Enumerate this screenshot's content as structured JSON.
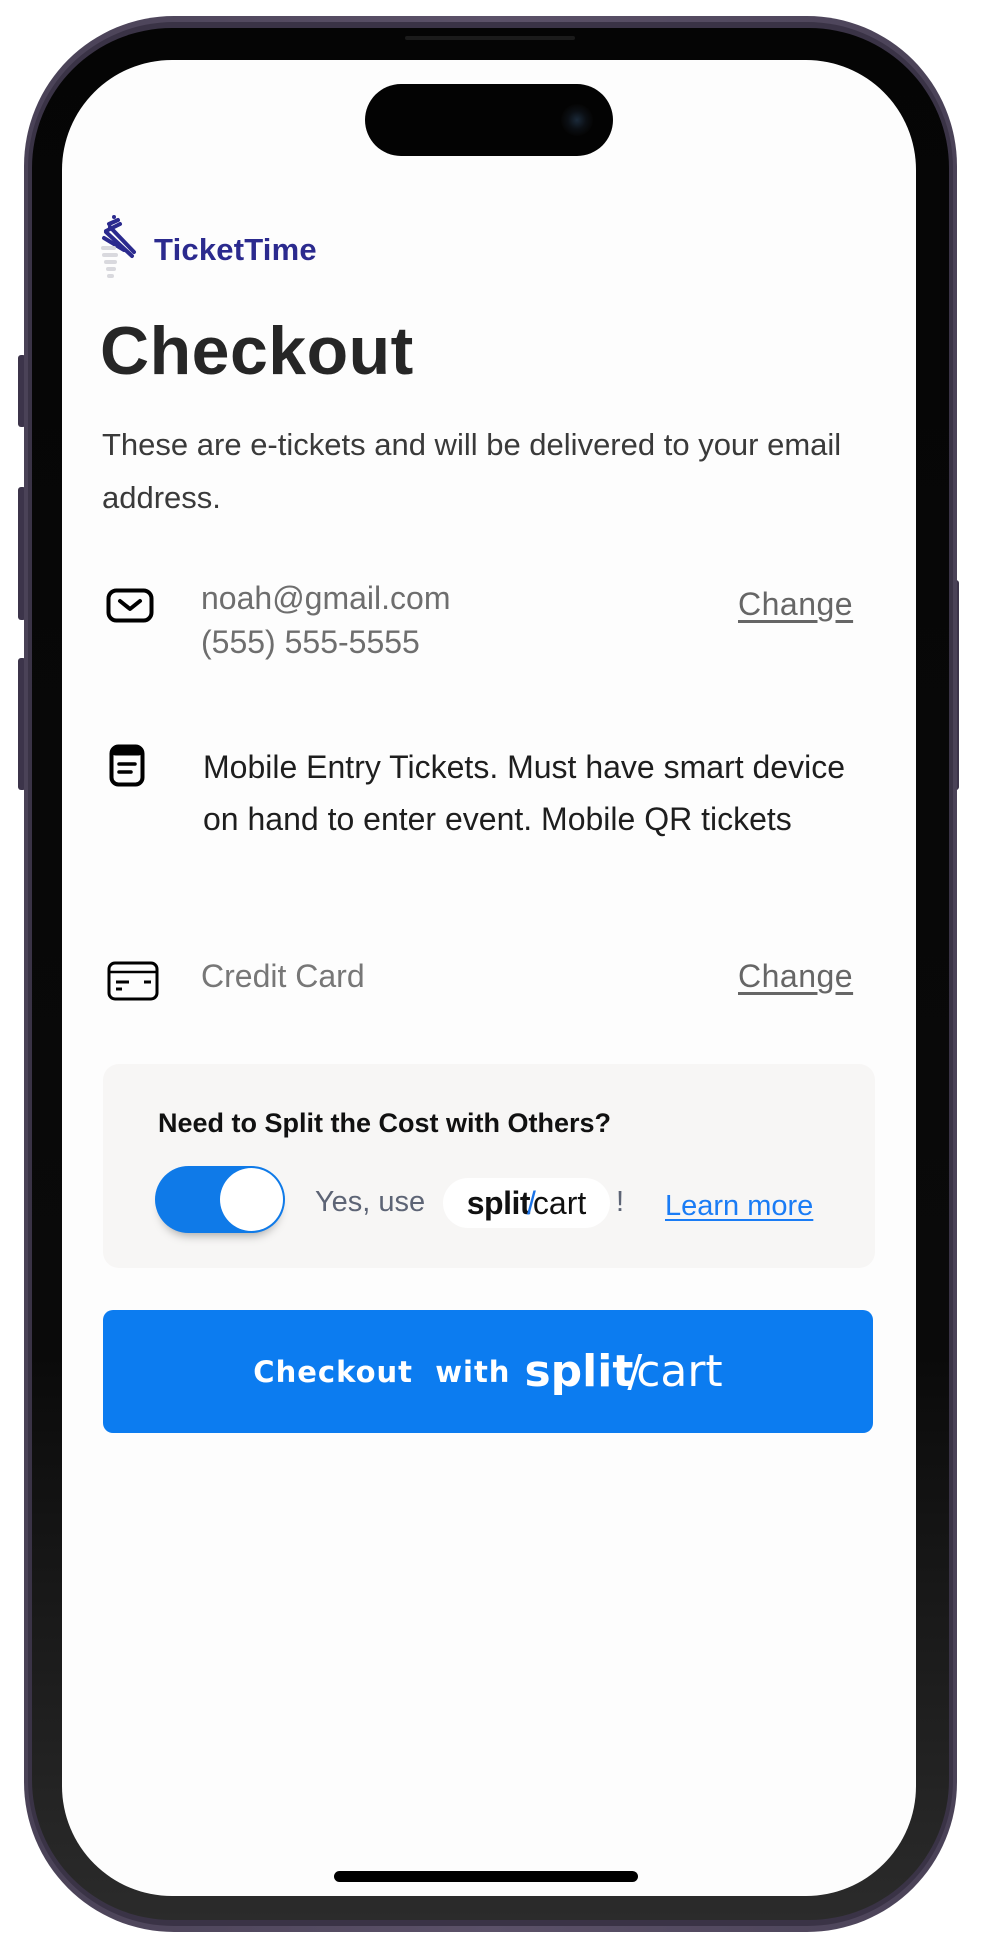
{
  "brand": {
    "name": "TicketTime",
    "color": "#2b2a8e"
  },
  "page": {
    "title": "Checkout",
    "subtitle": "These are e-tickets and will be delivered to your email address."
  },
  "contact": {
    "icon": "mail-icon",
    "email": "noah@gmail.com",
    "phone": "(555) 555-5555",
    "change_label": "Change"
  },
  "delivery": {
    "icon": "ticket-document-icon",
    "text": "Mobile Entry Tickets. Must have smart device on hand to enter event. Mobile QR tickets"
  },
  "payment": {
    "icon": "credit-card-icon",
    "method": "Credit Card",
    "change_label": "Change"
  },
  "split": {
    "heading": "Need to Split the Cost with Others?",
    "toggle_on": true,
    "yes_text": "Yes, use",
    "brand_bold": "split",
    "brand_slash": "/",
    "brand_light": "cart",
    "exclamation": "!",
    "learn_more": "Learn more",
    "accent": "#0f7ae8"
  },
  "checkout_button": {
    "label": "Checkout  with",
    "brand_bold": "split",
    "brand_slash": "/",
    "brand_light": "cart",
    "color": "#0c7cf0"
  }
}
